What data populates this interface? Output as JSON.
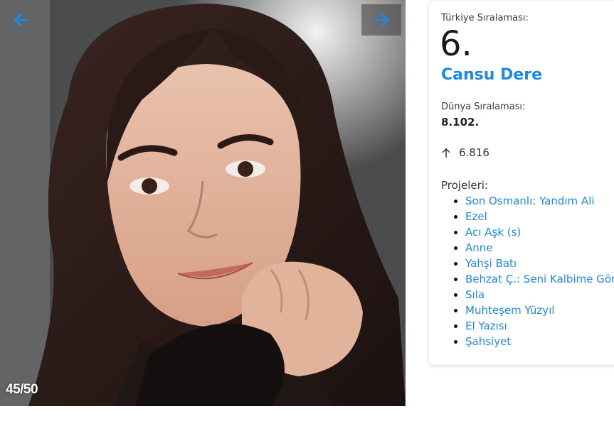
{
  "gallery": {
    "prev_icon": "arrow-left-icon",
    "next_icon": "arrow-right-icon",
    "counter": "45/50",
    "arrow_color": "#1e88e5"
  },
  "card": {
    "turkey_rank_label": "Türkiye Sıralaması:",
    "turkey_rank": "6.",
    "name": "Cansu Dere",
    "world_rank_label": "Dünya Sıralaması:",
    "world_rank": "8.102.",
    "trend_icon": "arrow-up-icon",
    "trend_value": "6.816",
    "projects_label": "Projeleri:",
    "projects": [
      "Son Osmanlı: Yandım Ali",
      "Ezel",
      "Acı Aşk (s)",
      "Anne",
      "Yahşi Batı",
      "Behzat Ç.: Seni Kalbime Gömdüm",
      "Sıla",
      "Muhteşem Yüzyıl",
      "El Yazısı",
      "Şahsiyet"
    ],
    "link_color": "#1e88e5"
  }
}
